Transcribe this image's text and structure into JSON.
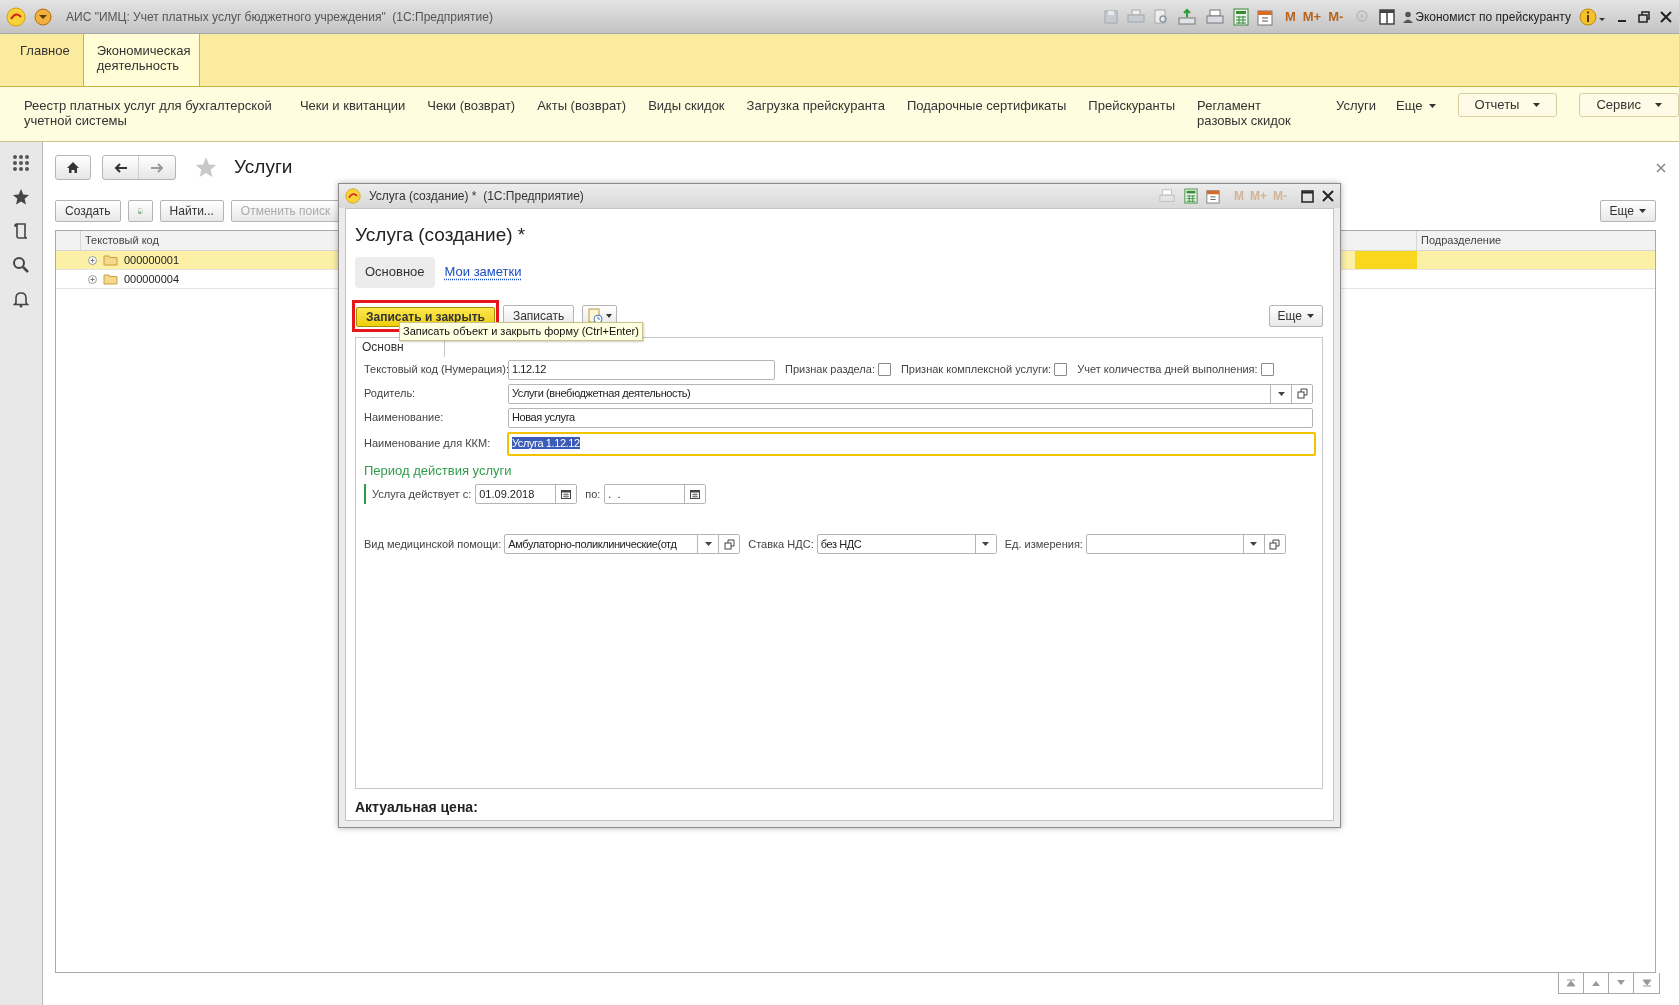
{
  "app_window": {
    "title": "АИС \"ИМЦ: Учет платных услуг бюджетного учреждения\"  (1С:Предприятие)",
    "memory_buttons": [
      {
        "label": "M",
        "disabled": false
      },
      {
        "label": "M+",
        "disabled": false
      },
      {
        "label": "M-",
        "disabled": false
      }
    ],
    "user": "Экономист по прейскуранту"
  },
  "sections": [
    {
      "label": "Главное",
      "selected": false
    },
    {
      "label": "Экономическая деятельность",
      "selected": true
    }
  ],
  "nav": {
    "links": [
      "Реестр платных услуг для бухгалтерской учетной системы",
      "Чеки и квитанции",
      "Чеки (возврат)",
      "Акты (возврат)",
      "Виды скидок",
      "Загрузка прейскуранта",
      "Подарочные сертификаты",
      "Прейскуранты",
      "Регламент разовых скидок",
      "Услуги"
    ],
    "more": "Еще",
    "buttons": [
      "Отчеты",
      "Сервис"
    ]
  },
  "list_form": {
    "title": "Услуги",
    "buttons": [
      "Создать",
      "Найти...",
      "Отменить поиск"
    ],
    "more": "Еще",
    "columns": [
      "Текстовый код",
      "Подразделение"
    ],
    "rows": [
      {
        "code": "000000001",
        "selected": true
      },
      {
        "code": "000000004",
        "selected": false
      }
    ]
  },
  "dialog": {
    "window_title": "Услуга (создание) *  (1С:Предприятие)",
    "memory_buttons": [
      {
        "label": "M",
        "disabled": true
      },
      {
        "label": "M+",
        "disabled": true
      },
      {
        "label": "M-",
        "disabled": true
      }
    ],
    "title": "Услуга (создание) *",
    "tabs": [
      {
        "label": "Основное",
        "selected": true
      },
      {
        "label": "Мои заметки",
        "selected": false
      }
    ],
    "buttons": [
      "Записать и закрыть",
      "Записать"
    ],
    "more": "Еще",
    "page_tab": "Основн",
    "tooltip": "Записать объект и закрыть форму (Ctrl+Enter)",
    "fields": [
      {
        "kind": "text",
        "label": "Текстовый код (Нумерация):",
        "value": "1.12.12",
        "focused": false,
        "flags": [
          {
            "label": "Признак раздела:",
            "checked": false
          },
          {
            "label": "Признак комплексной услуги:",
            "checked": false
          },
          {
            "label": "Учет количества дней выполнения:",
            "checked": false
          }
        ]
      },
      {
        "kind": "reference",
        "label": "Родитель:",
        "value": "Услуги (внебюджетная деятельность)",
        "focused": false
      },
      {
        "kind": "text",
        "label": "Наименование:",
        "value": "Новая услуга",
        "focused": false
      },
      {
        "kind": "text",
        "label": "Наименование для ККМ:",
        "value": "Услуга 1.12.12",
        "focused": true
      }
    ],
    "period": {
      "title": "Период действия услуги",
      "from_label": "Услуга действует с:",
      "from": "01.09.2018",
      "to_label": "по:",
      "to": ".  ."
    },
    "bottom_fields": [
      {
        "kind": "reference",
        "label": "Вид медицинской помощи:",
        "value": "Амбулаторно-поликлинические(отд"
      },
      {
        "kind": "select",
        "label": "Ставка НДС:",
        "value": "без НДС"
      },
      {
        "kind": "reference",
        "label": "Ед. измерения:"
      }
    ],
    "footer": "Актуальная цена:"
  }
}
